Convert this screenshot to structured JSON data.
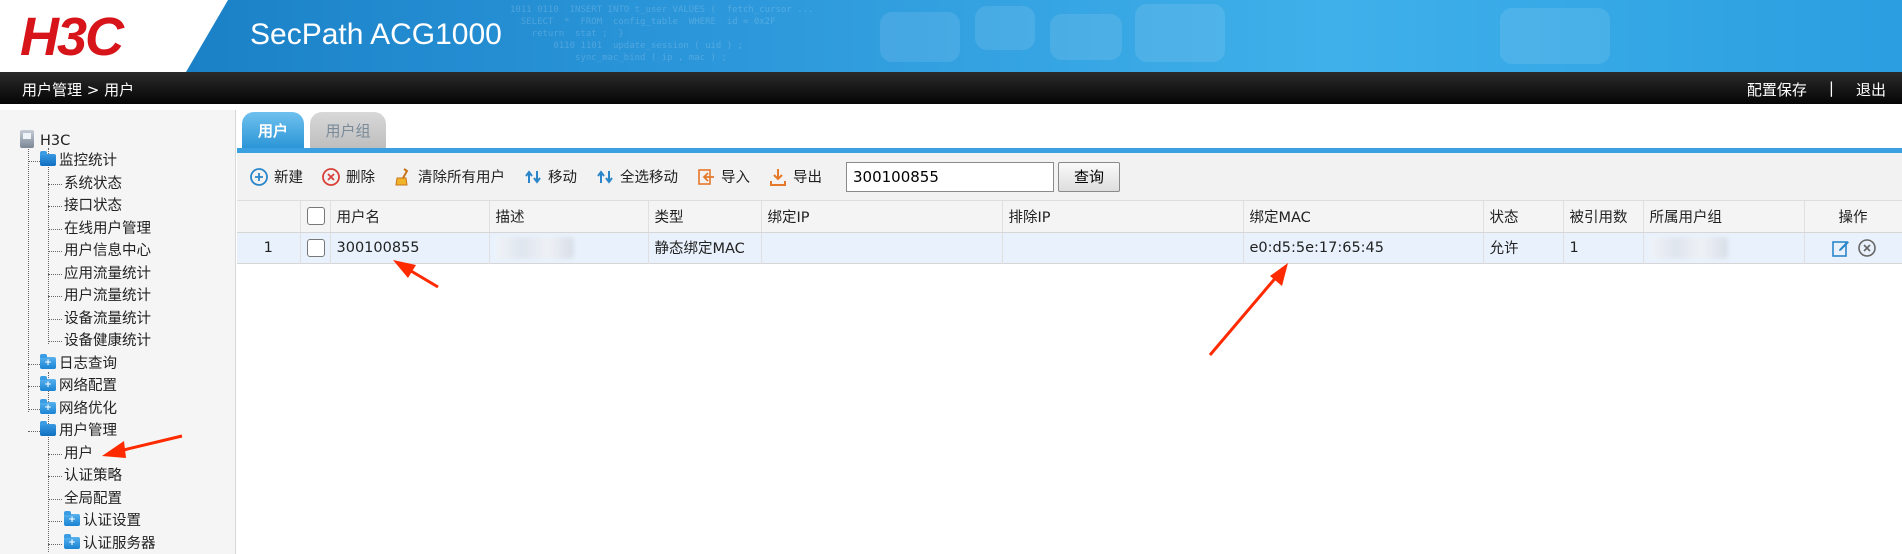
{
  "header": {
    "logo": "H3C",
    "product": "SecPath ACG1000",
    "code_deco": "1011 0110  INSERT INTO t_user VALUES (  fetch_cursor ...\n  SELECT  *  FROM  config_table  WHERE  id = 0x2F\n    return  stat ;  }\n        0110 1101  update_session ( uid ) ;\n            sync_mac_bind ( ip , mac ) ;"
  },
  "topbar": {
    "breadcrumb": "用户管理 > 用户",
    "save_config": "配置保存",
    "separator": "|",
    "logout": "退出"
  },
  "sidebar": {
    "root": "H3C",
    "items": [
      {
        "label": "监控统计"
      },
      {
        "label": "系统状态"
      },
      {
        "label": "接口状态"
      },
      {
        "label": "在线用户管理"
      },
      {
        "label": "用户信息中心"
      },
      {
        "label": "应用流量统计"
      },
      {
        "label": "用户流量统计"
      },
      {
        "label": "设备流量统计"
      },
      {
        "label": "设备健康统计"
      },
      {
        "label": "日志查询"
      },
      {
        "label": "网络配置"
      },
      {
        "label": "网络优化"
      },
      {
        "label": "用户管理"
      },
      {
        "label": "用户"
      },
      {
        "label": "认证策略"
      },
      {
        "label": "全局配置"
      },
      {
        "label": "认证设置"
      },
      {
        "label": "认证服务器"
      }
    ]
  },
  "tabs": [
    {
      "label": "用户"
    },
    {
      "label": "用户组"
    }
  ],
  "toolbar": {
    "new": "新建",
    "delete": "删除",
    "clear_all": "清除所有用户",
    "move": "移动",
    "move_all": "全选移动",
    "import": "导入",
    "export": "导出",
    "search_value": "300100855",
    "search_button": "查询"
  },
  "table": {
    "columns": [
      "用户名",
      "描述",
      "类型",
      "绑定IP",
      "排除IP",
      "绑定MAC",
      "状态",
      "被引用数",
      "所属用户组",
      "操作"
    ],
    "rows": [
      {
        "index": "1",
        "username": "300100855",
        "description": "",
        "type": "静态绑定MAC",
        "bind_ip": "",
        "exclude_ip": "",
        "bind_mac": "e0:d5:5e:17:65:45",
        "status": "允许",
        "ref_count": "1",
        "group": ""
      }
    ]
  },
  "colors": {
    "annotation_arrow": "#ff2a00",
    "accent": "#2893d6",
    "logo_red": "#d7141a"
  }
}
